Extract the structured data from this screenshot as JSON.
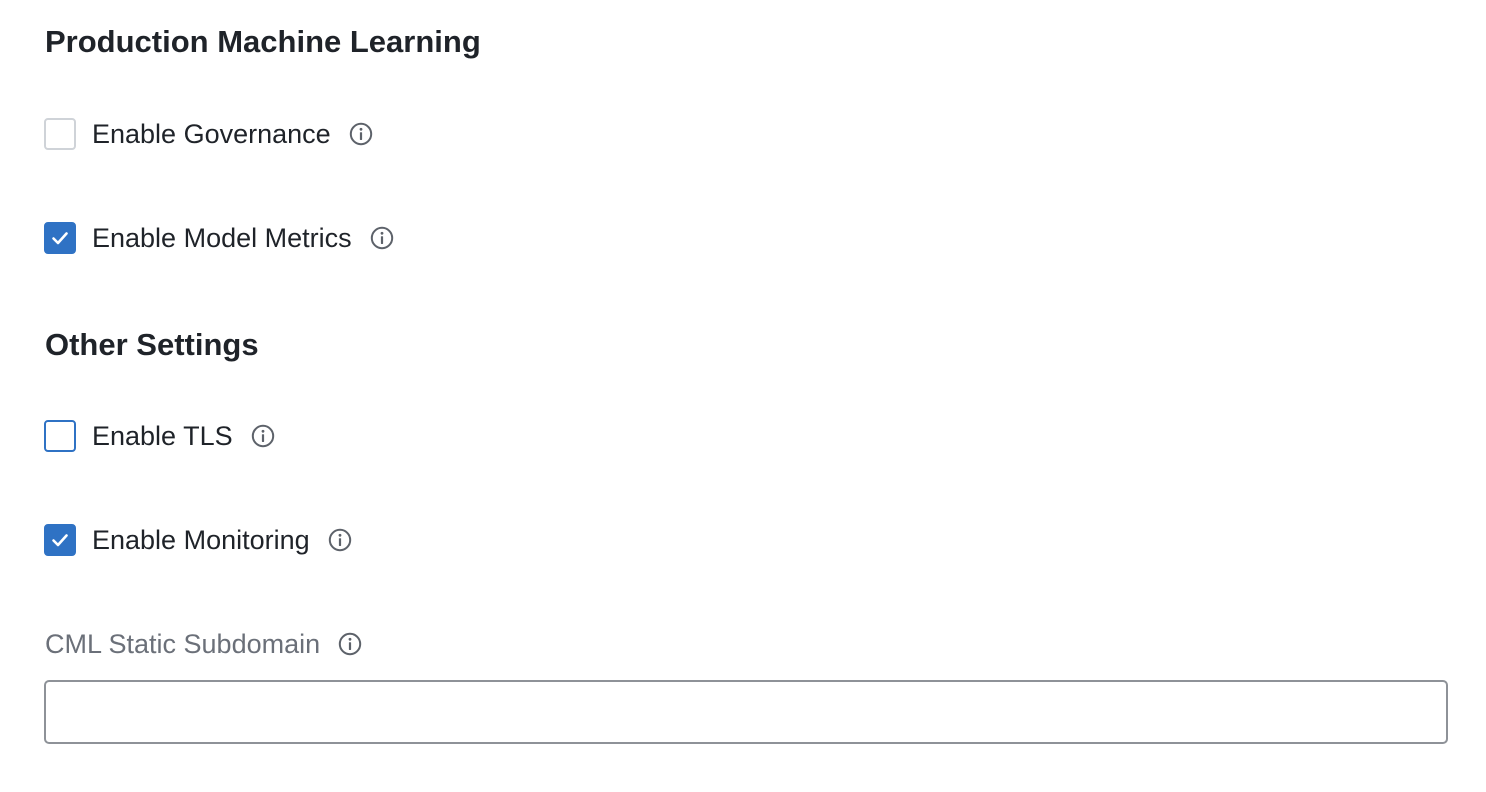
{
  "sections": {
    "production_ml": {
      "title": "Production Machine Learning",
      "options": [
        {
          "label": "Enable Governance",
          "checked": false
        },
        {
          "label": "Enable Model Metrics",
          "checked": true
        }
      ]
    },
    "other_settings": {
      "title": "Other Settings",
      "options": [
        {
          "label": "Enable TLS",
          "checked": false,
          "focused": true
        },
        {
          "label": "Enable Monitoring",
          "checked": true
        }
      ]
    }
  },
  "subdomain_field": {
    "label": "CML Static Subdomain",
    "value": "",
    "placeholder": ""
  },
  "icons": {
    "info": "info-circle-icon",
    "check": "check-icon"
  },
  "colors": {
    "accent": "#2f72c4",
    "heading_text": "#1f2329",
    "muted_label": "#6b7079",
    "unchecked_border": "#cfd3d8",
    "input_border": "#8e9298"
  }
}
